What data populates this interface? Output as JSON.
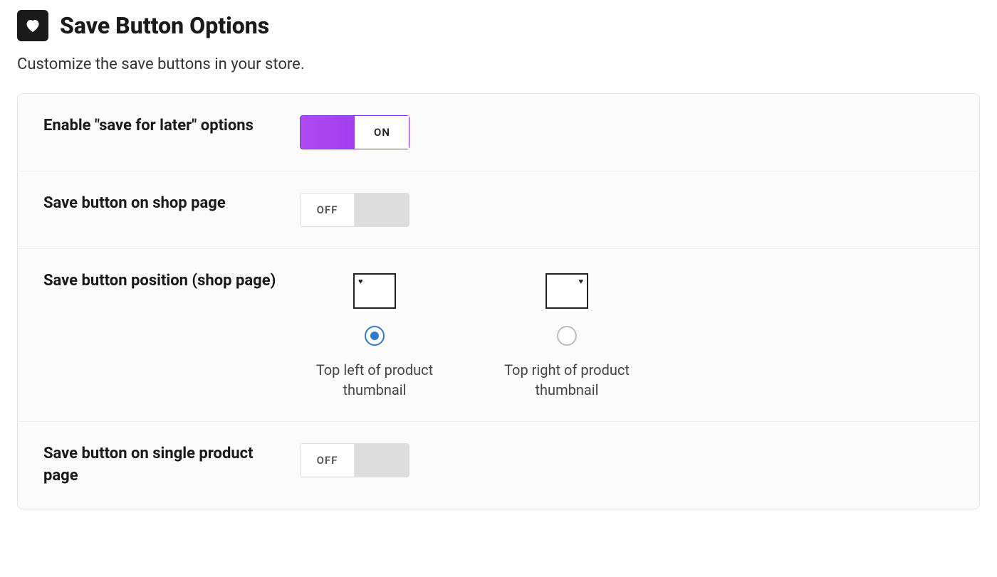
{
  "header": {
    "title": "Save Button Options",
    "icon": "heart-icon"
  },
  "subtitle": "Customize the save buttons in your store.",
  "rows": {
    "enable": {
      "label": "Enable \"save for later\" options",
      "toggle_state": "on",
      "toggle_text": "ON"
    },
    "shop_page_button": {
      "label": "Save button on shop page",
      "toggle_state": "off",
      "toggle_text": "OFF"
    },
    "shop_page_position": {
      "label": "Save button position (shop page)",
      "options": [
        {
          "caption": "Top left of product thumbnail",
          "heart_side": "left",
          "selected": true
        },
        {
          "caption": "Top right of product thumbnail",
          "heart_side": "right",
          "selected": false
        }
      ]
    },
    "single_product_button": {
      "label": "Save button on single product page",
      "toggle_state": "off",
      "toggle_text": "OFF"
    }
  }
}
